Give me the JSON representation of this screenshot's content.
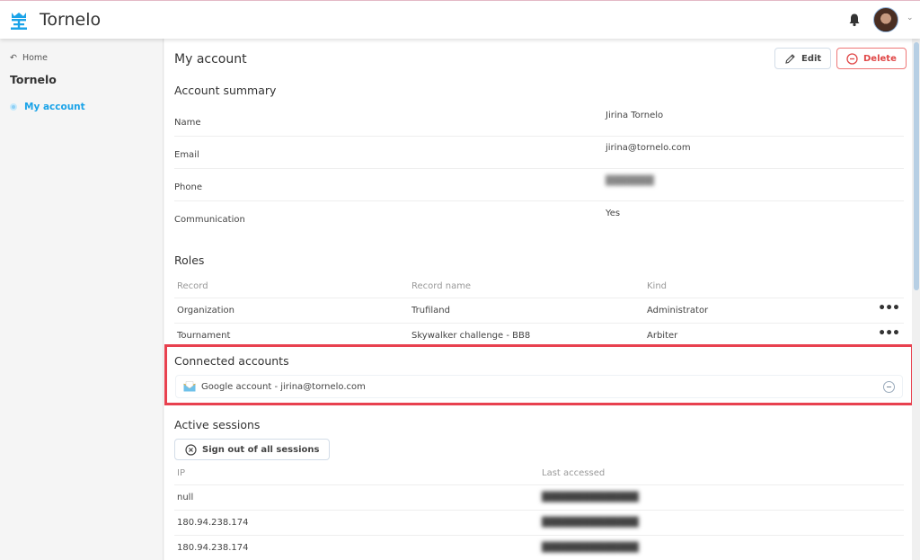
{
  "app": {
    "title": "Tornelo",
    "brand_color": "#1aa3e8",
    "danger_color": "#e04848",
    "highlight_color": "#e8414f"
  },
  "sidebar": {
    "back_label": "Home",
    "org_title": "Tornelo",
    "items": [
      {
        "label": "My account",
        "active": true
      }
    ]
  },
  "header": {
    "page_title": "My account",
    "edit_label": "Edit",
    "delete_label": "Delete"
  },
  "account_summary": {
    "title": "Account summary",
    "rows": [
      {
        "key": "Name",
        "value": "Jirina Tornelo"
      },
      {
        "key": "Email",
        "value": "jirina@tornelo.com"
      },
      {
        "key": "Phone",
        "value": "[redacted]"
      },
      {
        "key": "Communication",
        "value": "Yes"
      }
    ]
  },
  "roles": {
    "title": "Roles",
    "columns": [
      "Record",
      "Record name",
      "Kind"
    ],
    "rows": [
      {
        "record": "Organization",
        "record_name": "Trufiland",
        "kind": "Administrator"
      },
      {
        "record": "Tournament",
        "record_name": "Skywalker challenge - BB8",
        "kind": "Arbiter"
      }
    ]
  },
  "connected_accounts": {
    "title": "Connected accounts",
    "items": [
      {
        "label": "Google account - jirina@tornelo.com"
      }
    ]
  },
  "active_sessions": {
    "title": "Active sessions",
    "sign_out_label": "Sign out of all sessions",
    "columns": [
      "IP",
      "Last accessed"
    ],
    "rows": [
      {
        "ip": "null",
        "last_accessed": "[redacted]"
      },
      {
        "ip": "180.94.238.174",
        "last_accessed": "[redacted]"
      },
      {
        "ip": "180.94.238.174",
        "last_accessed": "[redacted]"
      }
    ]
  }
}
